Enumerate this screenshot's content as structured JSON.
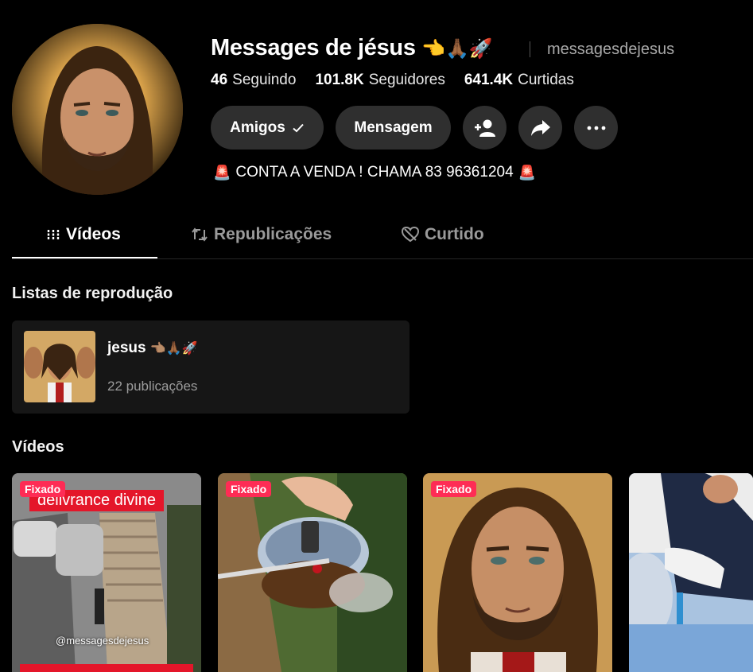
{
  "profile": {
    "display_name": "Messages de jésus",
    "name_emojis": "👈🙏🏾🚀",
    "handle": "messagesdejesus",
    "stats": [
      {
        "value": "46",
        "label": "Seguindo"
      },
      {
        "value": "101.8K",
        "label": "Seguidores"
      },
      {
        "value": "641.4K",
        "label": "Curtidas"
      }
    ],
    "bio": "CONTA A VENDA ! CHAMA 83 96361204",
    "bio_emoji": "🚨"
  },
  "actions": {
    "friends_label": "Amigos",
    "message_label": "Mensagem"
  },
  "tabs": [
    {
      "label": "Vídeos"
    },
    {
      "label": "Republicações"
    },
    {
      "label": "Curtido"
    }
  ],
  "sections": {
    "playlists_title": "Listas de reprodução",
    "videos_title": "Vídeos"
  },
  "playlist": {
    "name": "jesus",
    "emojis": "👈🏽🙏🏾🚀",
    "count": "22 publicações"
  },
  "videos": [
    {
      "badge": "Fixado",
      "overlay_title": "delivrance divine",
      "watermark": "@messagesdejesus"
    },
    {
      "badge": "Fixado"
    },
    {
      "badge": "Fixado"
    },
    {}
  ],
  "colors": {
    "background": "#000000",
    "button": "#2f2f2f",
    "pinned_badge": "#fe2c55",
    "muted_text": "#9a9a9a"
  },
  "icons": [
    "checkmark-icon",
    "add-user-icon",
    "share-icon",
    "more-icon",
    "grid-icon",
    "repost-icon",
    "heart-hidden-icon"
  ]
}
